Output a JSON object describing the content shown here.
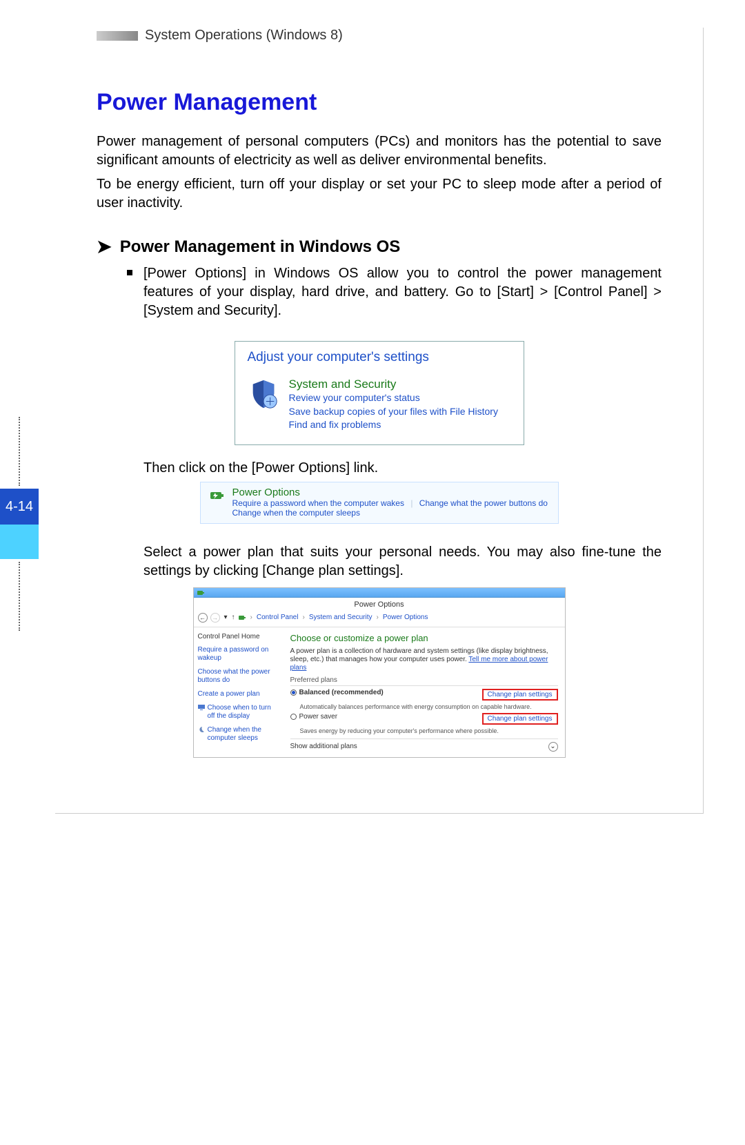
{
  "header": "System Operations (Windows 8)",
  "page_number": "4-14",
  "title": "Power Management",
  "intro_p1": "Power management of personal computers (PCs) and monitors has the potential to save significant amounts of electricity as well as deliver environmental benefits.",
  "intro_p2": "To be energy efficient, turn off your display or set your PC to sleep mode after a period of user inactivity.",
  "subhead": "Power Management in Windows OS",
  "bullet1": "[Power Options] in Windows OS allow you to control the power management features of your display, hard drive, and battery. Go to [Start] > [Control Panel] > [System and Security].",
  "shot1": {
    "heading": "Adjust your computer's settings",
    "group_title": "System and Security",
    "link1": "Review your computer's status",
    "link2": "Save backup copies of your files with File History",
    "link3": "Find and fix problems"
  },
  "then_text": "Then click on the [Power Options] link.",
  "shot2": {
    "title": "Power Options",
    "l1": "Require a password when the computer wakes",
    "l2": "Change what the power buttons do",
    "l3": "Change when the computer sleeps"
  },
  "select_text": "Select a power plan that suits your personal needs. You may also fine-tune the settings by clicking [Change plan settings].",
  "shot3": {
    "app_title": "Power Options",
    "crumb1": "Control Panel",
    "crumb2": "System and Security",
    "crumb3": "Power Options",
    "side_home": "Control Panel Home",
    "side_l1": "Require a password on wakeup",
    "side_l2": "Choose what the power buttons do",
    "side_l3": "Create a power plan",
    "side_l4": "Choose when to turn off the display",
    "side_l5": "Change when the computer sleeps",
    "main_hd": "Choose or customize a power plan",
    "main_desc": "A power plan is a collection of hardware and system settings (like display brightness, sleep, etc.) that manages how your computer uses power. ",
    "main_desc_link": "Tell me more about power plans",
    "pref": "Preferred plans",
    "plan1": "Balanced (recommended)",
    "plan1_sub": "Automatically balances performance with energy consumption on capable hardware.",
    "plan2": "Power saver",
    "plan2_sub": "Saves energy by reducing your computer's performance where possible.",
    "cps": "Change plan settings",
    "show_add": "Show additional plans"
  }
}
